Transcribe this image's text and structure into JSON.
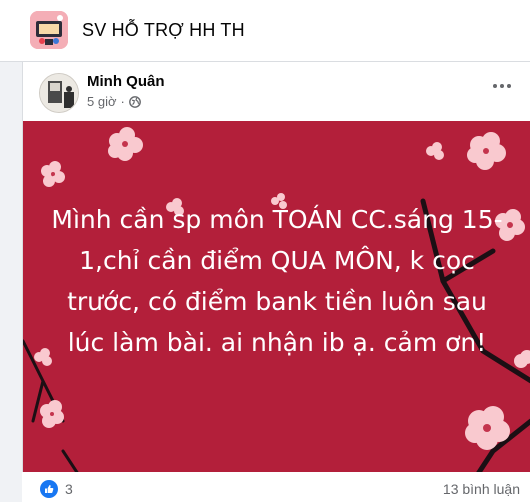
{
  "group": {
    "name": "SV HỖ TRỢ HH TH"
  },
  "post": {
    "author": "Minh Quân",
    "time": "5 giờ",
    "separator": "·",
    "text": "Mình cần sp môn TOÁN CC.sáng 15-1,chỉ cần điểm QUA MÔN, k cọc trước, có điểm bank tiền luôn sau lúc làm bài. ai nhận ib ạ. cảm ơn!",
    "background_color": "#b31f3a",
    "text_color": "#ffffff"
  },
  "reactions": {
    "like_count": "3",
    "comments": "13 bình luận"
  },
  "colors": {
    "accent": "#1877f2",
    "secondary_text": "#65676b"
  },
  "icons": [
    "group-avatar",
    "author-avatar",
    "globe-icon",
    "more-icon",
    "like-icon"
  ]
}
